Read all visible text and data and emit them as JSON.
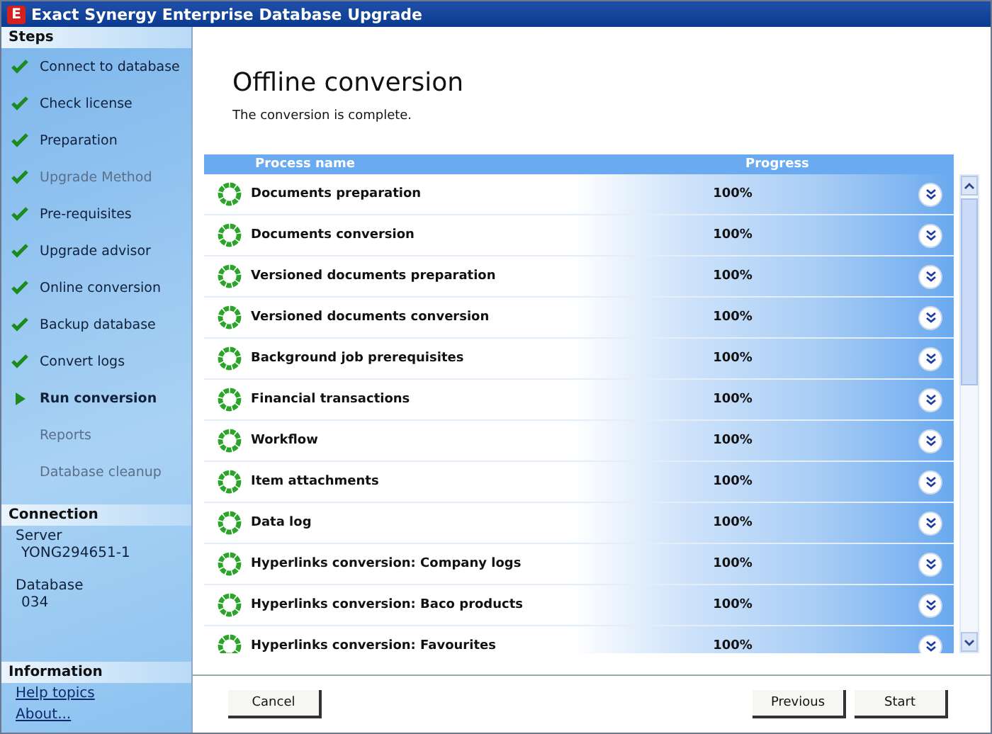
{
  "window": {
    "title": "Exact Synergy Enterprise Database Upgrade",
    "app_icon": "E"
  },
  "sidebar": {
    "steps_heading": "Steps",
    "steps": [
      {
        "label": "Connect to database",
        "checked": true,
        "selected": false,
        "disabled": false
      },
      {
        "label": "Check license",
        "checked": true,
        "selected": false,
        "disabled": false
      },
      {
        "label": "Preparation",
        "checked": true,
        "selected": false,
        "disabled": false
      },
      {
        "label": "Upgrade Method",
        "checked": true,
        "selected": false,
        "disabled": true
      },
      {
        "label": "Pre-requisites",
        "checked": true,
        "selected": false,
        "disabled": false
      },
      {
        "label": "Upgrade advisor",
        "checked": true,
        "selected": false,
        "disabled": false
      },
      {
        "label": "Online conversion",
        "checked": true,
        "selected": false,
        "disabled": false
      },
      {
        "label": "Backup database",
        "checked": true,
        "selected": false,
        "disabled": false
      },
      {
        "label": "Convert logs",
        "checked": true,
        "selected": false,
        "disabled": false
      },
      {
        "label": "Run conversion",
        "checked": false,
        "selected": true,
        "disabled": false
      },
      {
        "label": "Reports",
        "checked": false,
        "selected": false,
        "disabled": true
      },
      {
        "label": "Database cleanup",
        "checked": false,
        "selected": false,
        "disabled": true
      }
    ],
    "connection_heading": "Connection",
    "connection": [
      {
        "label": "Server",
        "value": "YONG294651-1"
      },
      {
        "label": "Database",
        "value": "034"
      }
    ],
    "information_heading": "Information",
    "links": [
      "Help topics",
      "About..."
    ]
  },
  "page": {
    "title": "Offline conversion",
    "message": "The conversion is complete."
  },
  "table": {
    "columns": [
      "Process name",
      "Progress"
    ],
    "rows": [
      {
        "name": "Documents preparation",
        "progress": "100%"
      },
      {
        "name": "Documents conversion",
        "progress": "100%"
      },
      {
        "name": "Versioned documents preparation",
        "progress": "100%"
      },
      {
        "name": "Versioned documents conversion",
        "progress": "100%"
      },
      {
        "name": "Background job prerequisites",
        "progress": "100%"
      },
      {
        "name": "Financial transactions",
        "progress": "100%"
      },
      {
        "name": "Workflow",
        "progress": "100%"
      },
      {
        "name": "Item attachments",
        "progress": "100%"
      },
      {
        "name": "Data log",
        "progress": "100%"
      },
      {
        "name": "Hyperlinks conversion: Company logs",
        "progress": "100%"
      },
      {
        "name": "Hyperlinks conversion: Baco products",
        "progress": "100%"
      },
      {
        "name": "Hyperlinks conversion: Favourites",
        "progress": "100%"
      }
    ]
  },
  "buttons": {
    "cancel": "Cancel",
    "previous": "Previous",
    "start": "Start"
  }
}
